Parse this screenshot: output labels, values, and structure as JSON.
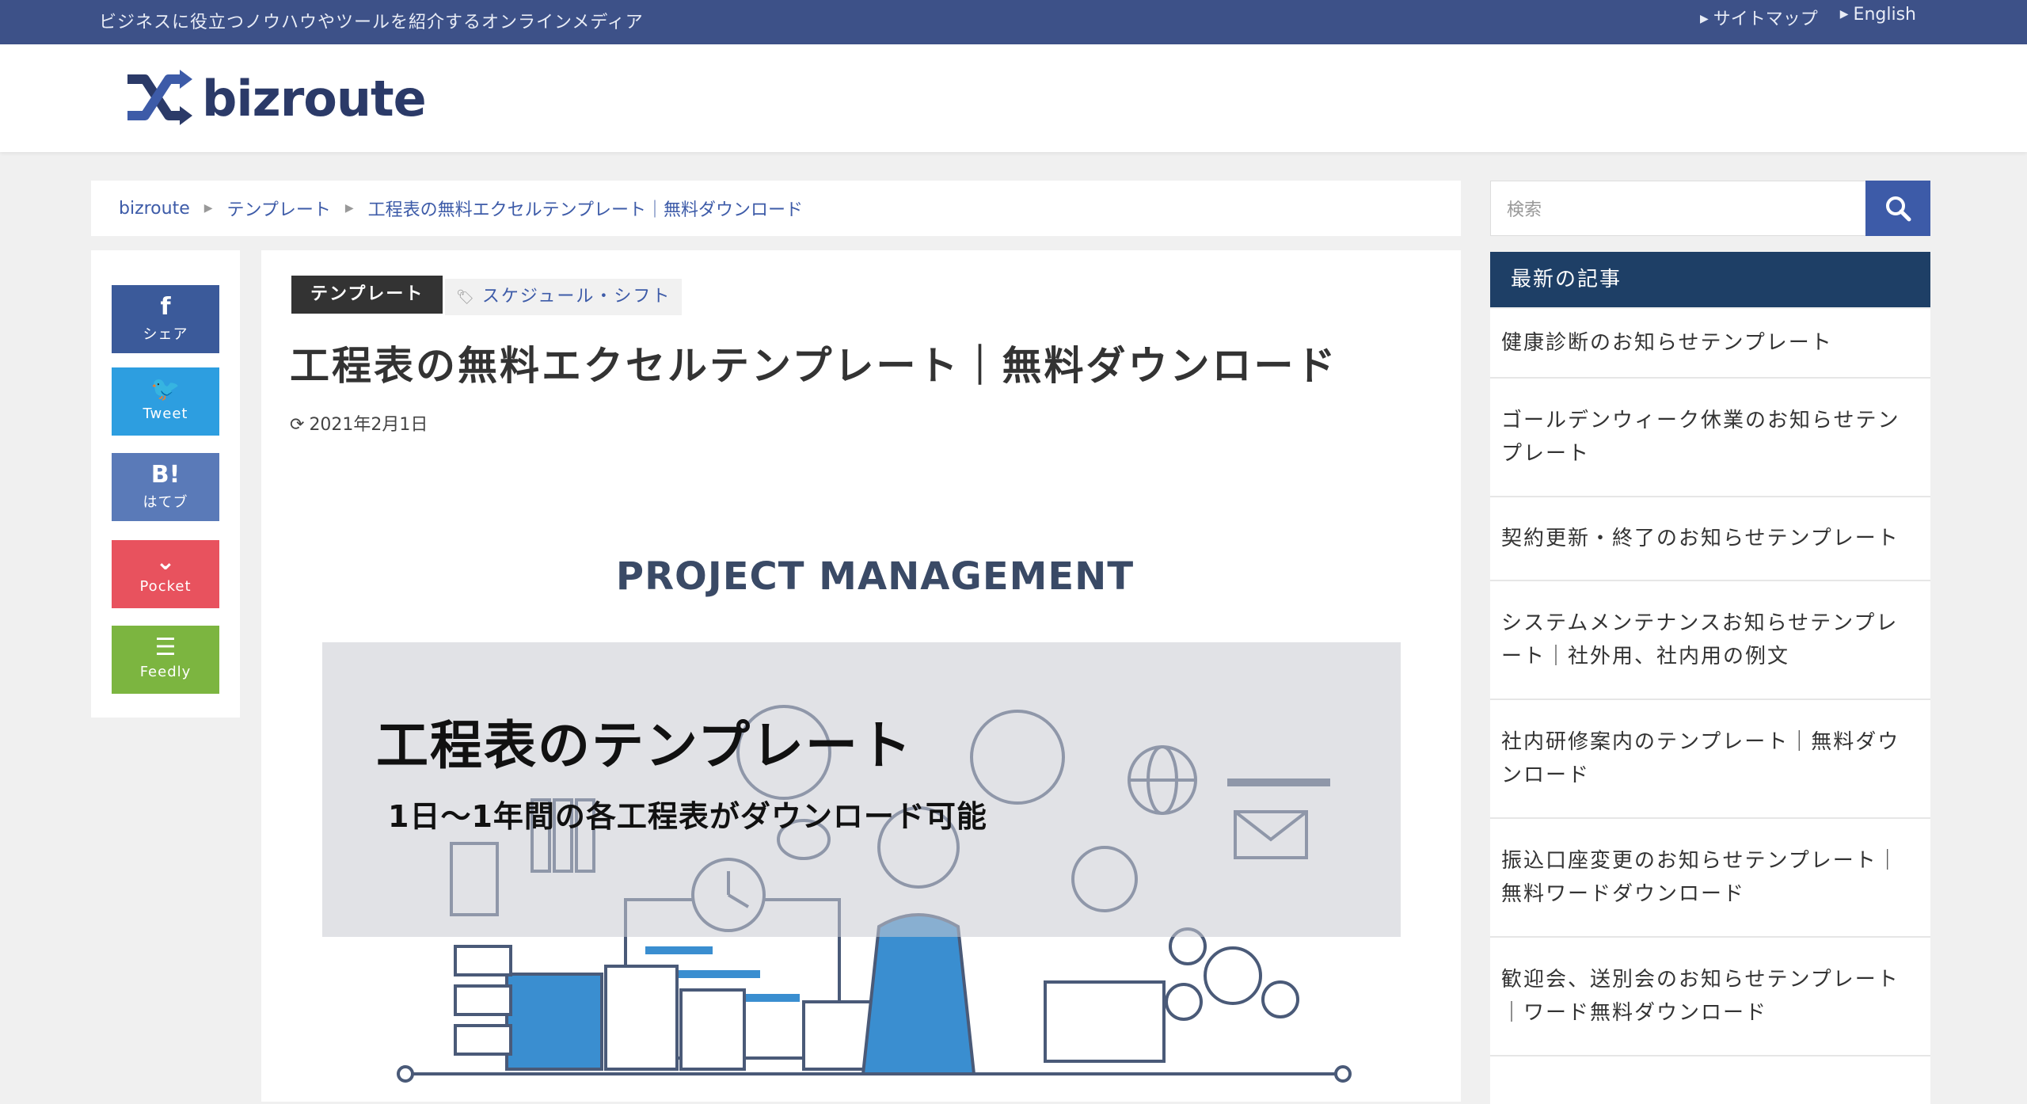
{
  "topbar": {
    "tagline": "ビジネスに役立つノウハウやツールを紹介するオンラインメディア",
    "links": [
      "サイトマップ",
      "English"
    ]
  },
  "logo": {
    "text": "bizroute"
  },
  "breadcrumb": [
    "bizroute",
    "テンプレート",
    "工程表の無料エクセルテンプレート｜無料ダウンロード"
  ],
  "share": [
    {
      "icon": "f",
      "label": "シェア"
    },
    {
      "icon": "🐦",
      "label": "Tweet"
    },
    {
      "icon": "B!",
      "label": "はてブ"
    },
    {
      "icon": "⌄",
      "label": "Pocket"
    },
    {
      "icon": "☰",
      "label": "Feedly"
    }
  ],
  "article": {
    "category": "テンプレート",
    "tag": "スケジュール・シフト",
    "title": "工程表の無料エクセルテンプレート｜無料ダウンロード",
    "date": "2021年2月1日",
    "hero": {
      "heading": "PROJECT MANAGEMENT",
      "overlay_title": "工程表のテンプレート",
      "overlay_sub": "1日〜1年間の各工程表がダウンロード可能"
    }
  },
  "sidebar": {
    "search_placeholder": "検索",
    "recent_heading": "最新の記事",
    "recent": [
      "健康診断のお知らせテンプレート",
      "ゴールデンウィーク休業のお知らせテンプレート",
      "契約更新・終了のお知らせテンプレート",
      "システムメンテナンスお知らせテンプレート｜社外用、社内用の例文",
      "社内研修案内のテンプレート｜無料ダウンロード",
      "振込口座変更のお知らせテンプレート｜無料ワードダウンロード",
      "歓迎会、送別会のお知らせテンプレート｜ワード無料ダウンロード"
    ]
  },
  "colors": {
    "topbar": "#3d5188",
    "accent": "#3d5ba8",
    "sidebar_heading": "#1e3f66",
    "facebook": "#3b5a9a",
    "twitter": "#2d9ee0",
    "hatena": "#5a7ab8",
    "pocket": "#e8525e",
    "feedly": "#7cb540"
  }
}
